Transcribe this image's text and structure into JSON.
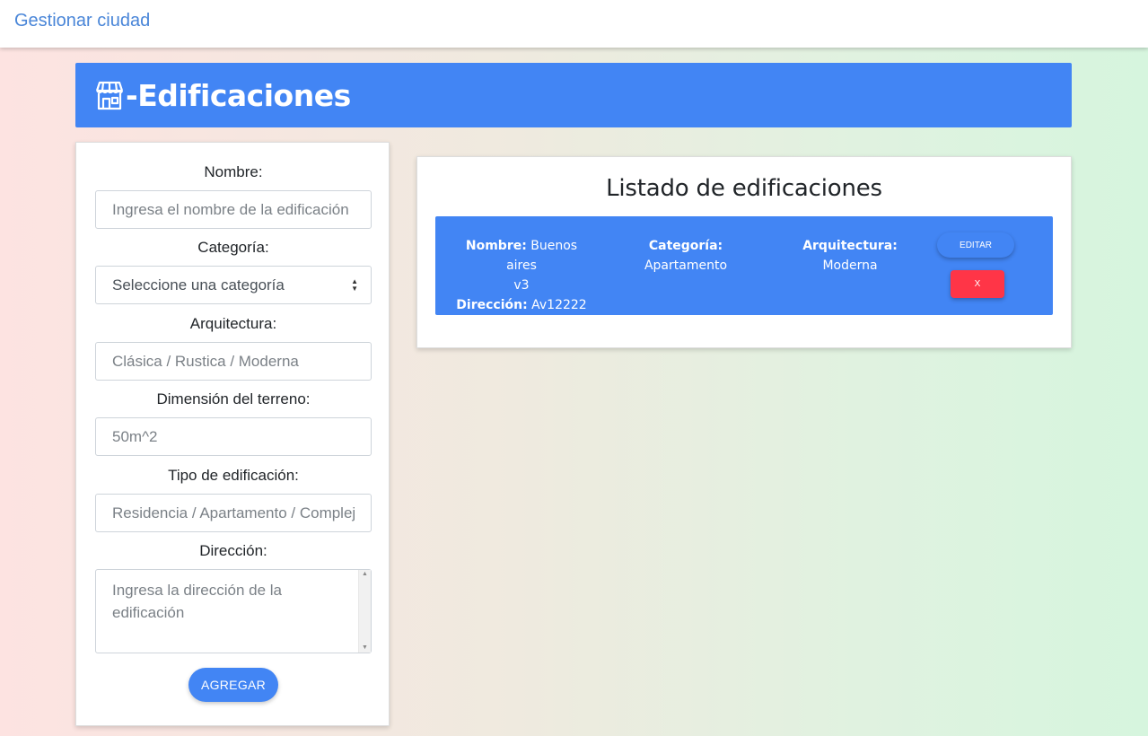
{
  "navbar": {
    "brand": "Gestionar ciudad"
  },
  "banner": {
    "icon": "store-icon",
    "title": "-Edificaciones"
  },
  "form": {
    "nombre_label": "Nombre:",
    "nombre_placeholder": "Ingresa el nombre de la edificación",
    "categoria_label": "Categoría:",
    "categoria_selected": "Seleccione una categoría",
    "arquitectura_label": "Arquitectura:",
    "arquitectura_placeholder": "Clásica / Rustica / Moderna",
    "dimension_label": "Dimensión del terreno:",
    "dimension_placeholder": "50m^2",
    "tipo_label": "Tipo de edificación:",
    "tipo_placeholder": "Residencia / Apartamento / Complej",
    "direccion_label": "Dirección:",
    "direccion_placeholder": "Ingresa la dirección de la edificación",
    "submit_label": "AGREGAR"
  },
  "listado": {
    "title": "Listado de edificaciones",
    "items": [
      {
        "nombre_label": "Nombre:",
        "nombre_value_1": "Buenos aires",
        "nombre_value_2": "v3",
        "direccion_label": "Dirección:",
        "direccion_value": "Av12222",
        "categoria_label": "Categoría:",
        "categoria_value": "Apartamento",
        "arquitectura_label": "Arquitectura:",
        "arquitectura_value": "Moderna",
        "edit_label": "EDITAR",
        "delete_label": "X"
      }
    ]
  },
  "colors": {
    "primary": "#4285f4",
    "danger": "#ff3547",
    "brand_text": "#4a86d8"
  }
}
